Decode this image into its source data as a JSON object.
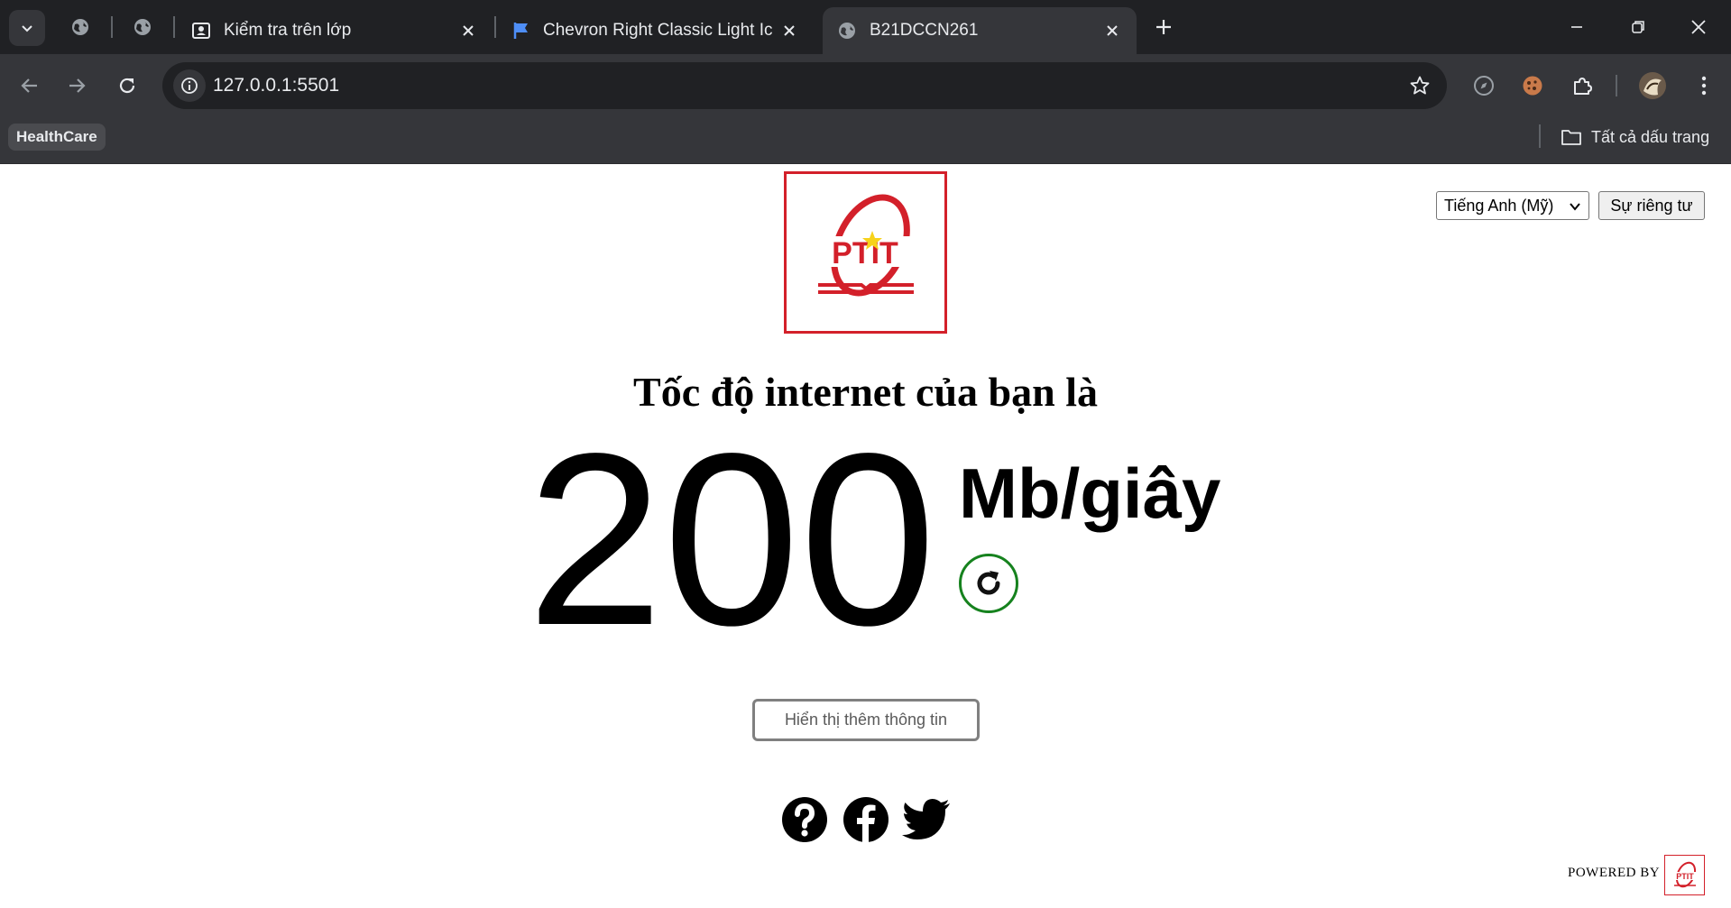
{
  "browser": {
    "tabs": [
      {
        "title": "Kiểm tra trên lớp",
        "icon": "classroom-icon",
        "active": false
      },
      {
        "title": "Chevron Right Classic Light Icon",
        "icon": "flag-icon",
        "active": false
      },
      {
        "title": "B21DCCN261",
        "icon": "globe-icon",
        "active": true
      }
    ],
    "url": "127.0.0.1:5501",
    "bookmarks": {
      "items": [
        {
          "label": "HealthCare"
        }
      ],
      "all_bookmarks_label": "Tất cả dấu trang"
    },
    "colors": {
      "tabstrip": "#202124",
      "toolbar": "#35363a",
      "text": "#e8eaed"
    }
  },
  "page": {
    "language_select": {
      "selected": "Tiếng Anh (Mỹ)"
    },
    "privacy_label": "Sự riêng tư",
    "logo_text": "PTIT",
    "headline": "Tốc độ internet của bạn là",
    "speed": {
      "value": "200",
      "unit": "Mb/giây"
    },
    "more_info_label": "Hiển thị thêm thông tin",
    "social_icons": [
      "help-icon",
      "facebook-icon",
      "twitter-icon"
    ],
    "powered_by_label": "POWERED BY",
    "colors": {
      "brand_red": "#d3202a",
      "refresh_green": "#16821e",
      "button_border": "#808080"
    }
  }
}
